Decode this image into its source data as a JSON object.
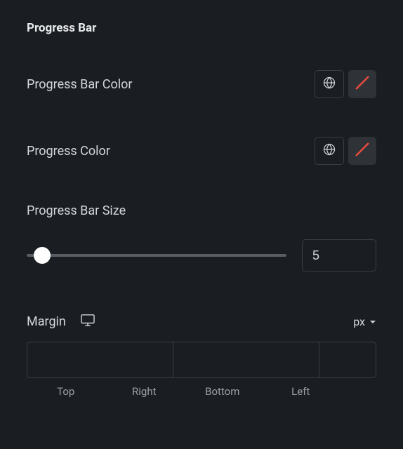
{
  "section": {
    "title": "Progress Bar"
  },
  "controls": {
    "bgcolor": {
      "label": "Progress Bar Color"
    },
    "progcolor": {
      "label": "Progress Color"
    },
    "size": {
      "label": "Progress Bar Size",
      "value": "5"
    },
    "margin": {
      "label": "Margin",
      "unit": "px",
      "sides": {
        "top": "Top",
        "right": "Right",
        "bottom": "Bottom",
        "left": "Left"
      },
      "values": {
        "top": "",
        "right": "",
        "bottom": "",
        "left": ""
      }
    }
  }
}
